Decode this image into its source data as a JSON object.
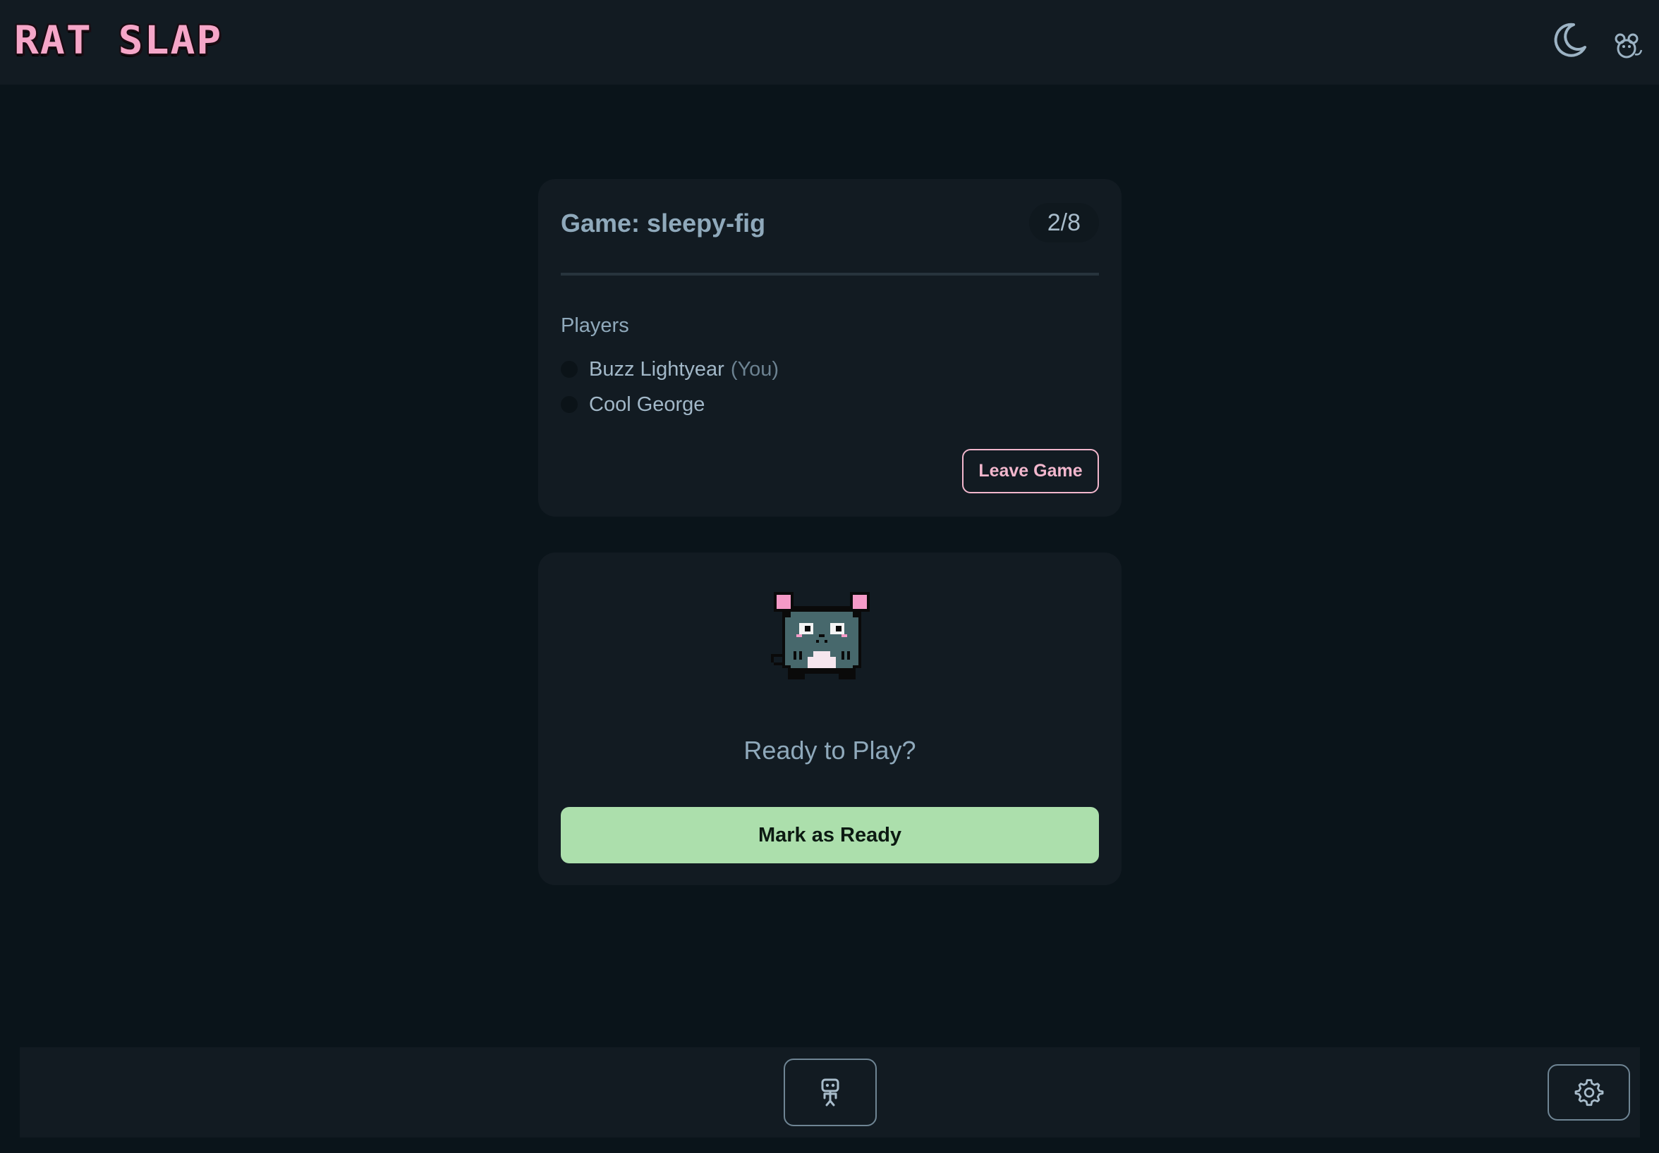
{
  "header": {
    "logo_text": "RAT SLAP",
    "theme_toggle_icon": "moon-icon",
    "profile_icon": "rat-icon"
  },
  "lobby": {
    "game_title": "Game: sleepy-fig",
    "player_count": "2/8",
    "players_heading": "Players",
    "players": [
      {
        "name": "Buzz Lightyear",
        "tag": "(You)"
      },
      {
        "name": "Cool George",
        "tag": ""
      }
    ],
    "leave_button": "Leave Game"
  },
  "ready_panel": {
    "avatar_icon": "pixel-rat-icon",
    "heading": "Ready to Play?",
    "ready_button": "Mark as Ready"
  },
  "footer": {
    "bot_icon": "robot-icon",
    "settings_icon": "gear-icon"
  },
  "colors": {
    "page_background": "#0a141a",
    "panel_background": "#121b22",
    "logo_pink": "#f5a6c8",
    "leave_accent": "#f2b7cd",
    "ready_green": "#acdfac",
    "text_muted": "#8fa9bb"
  }
}
